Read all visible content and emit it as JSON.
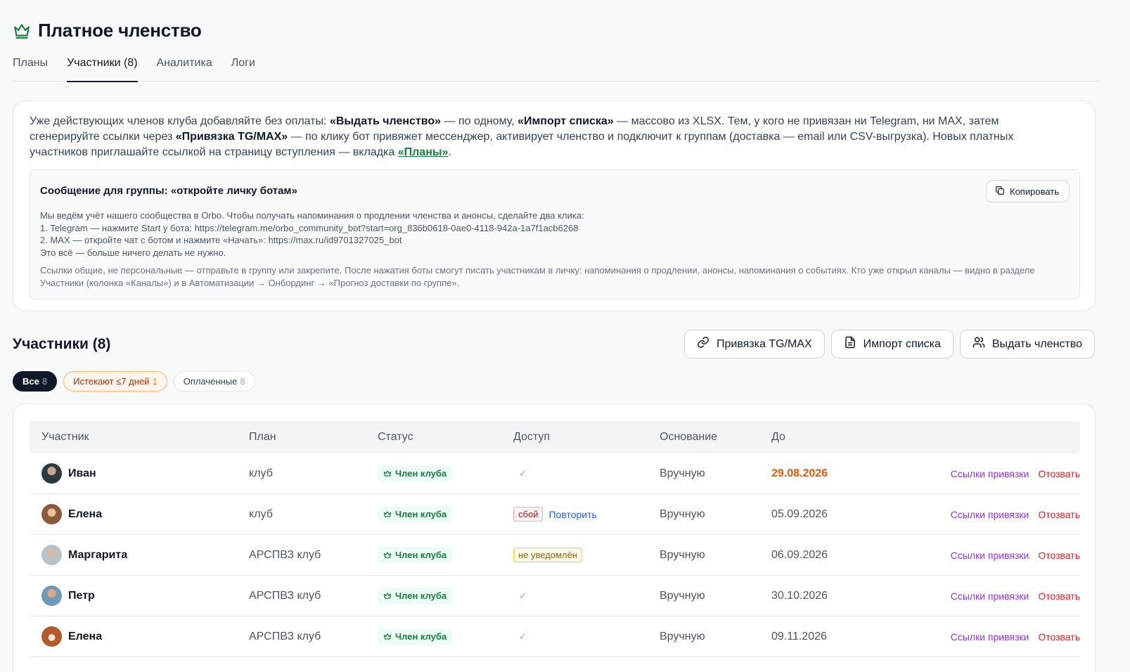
{
  "page": {
    "title": "Платное членство",
    "icon": "crown-icon",
    "accent": "#15803d"
  },
  "tabs": [
    {
      "label": "Планы",
      "active": false
    },
    {
      "label": "Участники (8)",
      "active": true
    },
    {
      "label": "Аналитика",
      "active": false
    },
    {
      "label": "Логи",
      "active": false
    }
  ],
  "info": {
    "p1": "Уже действующих членов клуба добавляйте без оплаты: ",
    "b1": "«Выдать членство»",
    "p2": " — по одному, ",
    "b2": "«Импорт списка»",
    "p3": " — массово из XLSX. Тем, у кого не привязан ни Telegram, ни MAX, затем сгенерируйте ссылки через ",
    "b3": "«Привязка TG/MAX»",
    "p4": " — по клику бот привяжет мессенджер, активирует членство и подключит к группам (доставка — email или CSV-выгрузка). Новых платных участников приглашайте ссылкой на страницу вступления — вкладка ",
    "link": "«Планы»",
    "p5": "."
  },
  "message": {
    "title": "Сообщение для группы: «откройте личку ботам»",
    "copy_label": "Копировать",
    "lines": [
      "Мы ведём учёт нашего сообщества в Orbo. Чтобы получать напоминания о продлении членства и анонсы, сделайте два клика:",
      "1. Telegram — нажмите Start у бота: https://telegram.me/orbo_community_bot?start=org_836b0618-0ae0-4118-942a-1a7f1acb6268",
      "2. MAX — откройте чат с ботом и нажмите «Начать»: https://max.ru/id9701327025_bot",
      "Это всё — больше ничего делать не нужно."
    ],
    "note": "Ссылки общие, не персональные — отправьте в группу или закрепите. После нажатия боты смогут писать участникам в личку: напоминания о продлении, анонсы, напоминания о событиях. Кто уже открыл каналы — видно в разделе Участники (колонка «Каналы») и в Автоматизации → Онбординг → «Прогноз доставки по группе»."
  },
  "section": {
    "title": "Участники (8)",
    "buttons": {
      "link_tg_max": "Привязка TG/MAX",
      "import_list": "Импорт списка",
      "grant_membership": "Выдать членство"
    }
  },
  "filters": [
    {
      "label": "Все",
      "count": "8",
      "style": "dark"
    },
    {
      "label": "Истекают ≤7 дней",
      "count": "1",
      "style": "warn"
    },
    {
      "label": "Оплаченные",
      "count": "8",
      "style": "plain"
    }
  ],
  "table": {
    "headers": [
      "Участник",
      "План",
      "Статус",
      "Доступ",
      "Основание",
      "До"
    ],
    "member_badge": "Член клуба",
    "action_links": "Ссылки привязки",
    "action_revoke": "Отозвать",
    "retry": "Повторить",
    "rows": [
      {
        "name": "Иван",
        "plan": "клуб",
        "access": "✓",
        "basis": "Вручную",
        "until": "29.08.2026",
        "until_highlight": true
      },
      {
        "name": "Елена",
        "plan": "клуб",
        "access": "сбой",
        "basis": "Вручную",
        "until": "05.09.2026"
      },
      {
        "name": "Маргарита",
        "plan": "АРСПВЗ клуб",
        "access": "не уведомлён",
        "basis": "Вручную",
        "until": "06.09.2026"
      },
      {
        "name": "Петр",
        "plan": "АРСПВЗ клуб",
        "access": "✓",
        "basis": "Вручную",
        "until": "30.10.2026"
      },
      {
        "name": "Елена",
        "plan": "АРСПВЗ клуб",
        "access": "✓",
        "basis": "Вручную",
        "until": "09.11.2026"
      }
    ]
  }
}
